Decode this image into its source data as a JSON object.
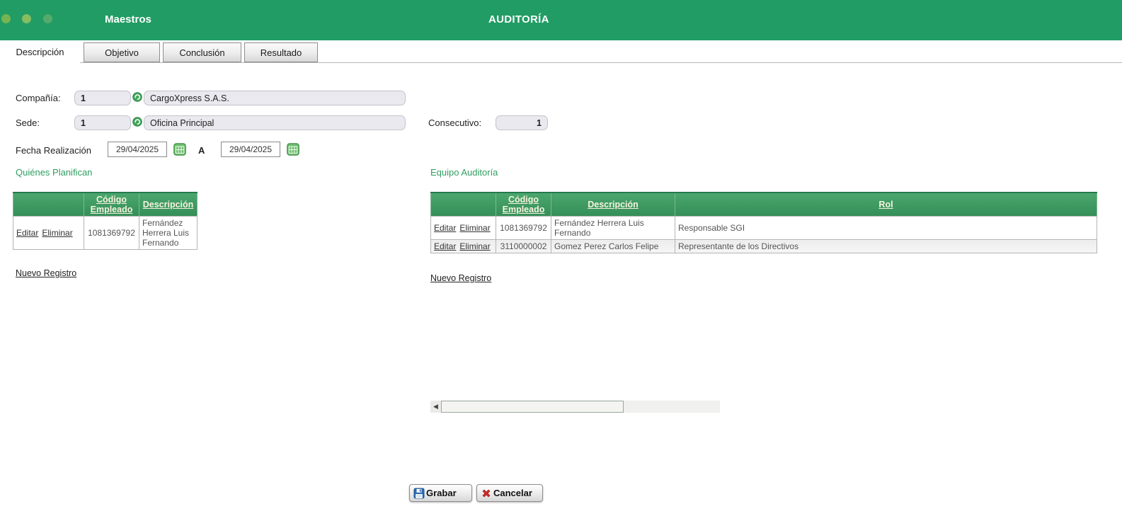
{
  "colors": {
    "header_bg": "#219c64",
    "accent_green": "#2f9e60",
    "table_header_top": "#4aa76d",
    "table_header_bottom": "#358f58",
    "save_icon_blue": "#2c6cb4",
    "cancel_icon_red": "#cf2a27"
  },
  "header": {
    "app_title": "Maestros",
    "page_title": "AUDITORÍA"
  },
  "tabs": [
    {
      "label": "Descripción",
      "active": true
    },
    {
      "label": "Objetivo",
      "active": false
    },
    {
      "label": "Conclusión",
      "active": false
    },
    {
      "label": "Resultado",
      "active": false
    }
  ],
  "form": {
    "compania_label": "Compañía:",
    "compania_code": "1",
    "compania_name": "CargoXpress S.A.S.",
    "sede_label": "Sede:",
    "sede_code": "1",
    "sede_name": "Oficina Principal",
    "consecutivo_label": "Consecutivo:",
    "consecutivo_value": "1",
    "fecha_label": "Fecha Realización",
    "fecha_desde": "29/04/2025",
    "fecha_separator": "A",
    "fecha_hasta": "29/04/2025"
  },
  "table_actions": {
    "edit": "Editar",
    "delete": "Eliminar"
  },
  "planners": {
    "title": "Quiénes Planifican",
    "col_codigo": "Código Empleado",
    "col_descripcion": "Descripción",
    "rows": [
      {
        "codigo": "1081369792",
        "descripcion": "Fernández Herrera Luis Fernando"
      }
    ],
    "new_link": "Nuevo Registro"
  },
  "team": {
    "title": "Equipo Auditoría",
    "col_codigo": "Código Empleado",
    "col_descripcion": "Descripción",
    "col_rol": "Rol",
    "rows": [
      {
        "codigo": "1081369792",
        "descripcion": "Fernández Herrera Luis Fernando",
        "rol": "Responsable SGI"
      },
      {
        "codigo": "3110000002",
        "descripcion": "Gomez Perez Carlos Felipe",
        "rol": "Representante de los Directivos"
      }
    ],
    "new_link": "Nuevo Registro"
  },
  "footer": {
    "save_label": "Grabar",
    "cancel_label": "Cancelar"
  }
}
